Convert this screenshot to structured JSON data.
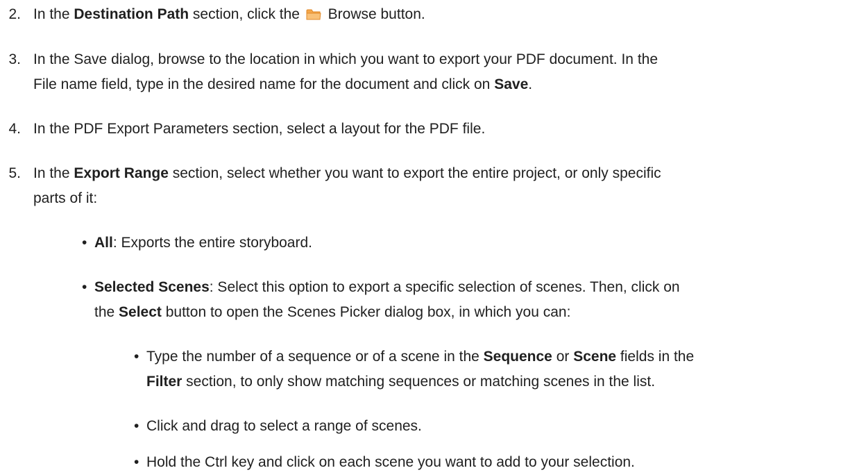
{
  "steps": {
    "s2": {
      "num": "2.",
      "t1": "In the ",
      "b1": "Destination Path",
      "t2": " section, click the ",
      "t3": " Browse button."
    },
    "s3": {
      "num": "3.",
      "l1": "In the Save dialog, browse to the location in which you want to export your PDF document. In the",
      "l2a": "File name field, type in the desired name for the document and click on ",
      "l2b": "Save",
      "l2c": "."
    },
    "s4": {
      "num": "4.",
      "text": "In the PDF Export Parameters section, select a layout for the PDF file."
    },
    "s5": {
      "num": "5.",
      "t1": "In the ",
      "b1": "Export Range",
      "t2": " section, select whether you want to export the entire project, or only specific",
      "l2": "parts of it:"
    }
  },
  "bullets": {
    "all": {
      "bold": "All",
      "text": ": Exports the entire storyboard."
    },
    "selected": {
      "bold": "Selected Scenes",
      "t1": ": Select this option to export a specific selection of scenes. Then, click on",
      "l2a": "the ",
      "l2b": "Select",
      "l2c": " button to open the Scenes Picker dialog box, in which you can:"
    }
  },
  "subbullets": {
    "type": {
      "t1": "Type the number of a sequence or of a scene in the ",
      "b1": "Sequence",
      "t2": " or ",
      "b2": "Scene",
      "t3": " fields in the",
      "l2b": "Filter",
      "l2c": " section, to only show matching sequences or matching scenes in the list."
    },
    "drag": {
      "text": "Click and drag to select a range of scenes."
    },
    "ctrl": {
      "text": "Hold the Ctrl key and click on each scene you want to add to your selection."
    }
  },
  "bullet_glyph": "•",
  "icons": {
    "browse": "folder-icon",
    "folder_color": "#f5a74a"
  }
}
